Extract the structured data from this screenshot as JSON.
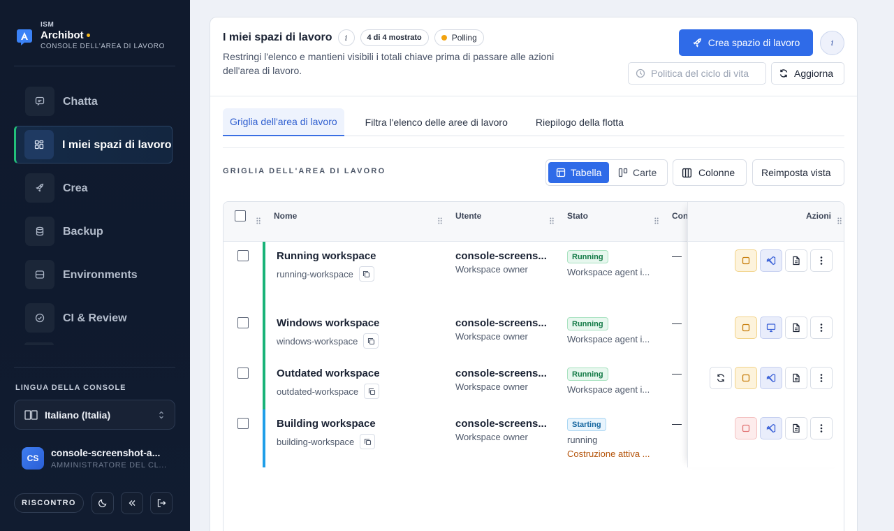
{
  "sidebar": {
    "brand": {
      "kicker": "ISM",
      "name": "Archibot",
      "subtitle": "CONSOLE DELL'AREA DI LAVORO"
    },
    "nav": [
      {
        "label": "Chatta",
        "icon": "chat-icon",
        "active": false
      },
      {
        "label": "I miei spazi di lavoro",
        "icon": "grid-icon",
        "active": true
      },
      {
        "label": "Crea",
        "icon": "rocket-icon",
        "active": false
      },
      {
        "label": "Backup",
        "icon": "database-icon",
        "active": false
      },
      {
        "label": "Environments",
        "icon": "server-icon",
        "active": false
      },
      {
        "label": "CI & Review",
        "icon": "check-circle-icon",
        "active": false
      }
    ],
    "language_label": "LINGUA DELLA CONSOLE",
    "language_value": "Italiano (Italia)",
    "user": {
      "initials": "CS",
      "name": "console-screenshot-a...",
      "role": "AMMINISTRATORE DEL CL..."
    },
    "feedback_label": "RISCONTRO"
  },
  "header": {
    "title": "I miei spazi di lavoro",
    "info": "i",
    "count_chip": "4 di 4 mostrato",
    "polling_chip": "Polling",
    "description": "Restringi l'elenco e mantieni visibili i totali chiave prima di passare alle azioni dell'area di lavoro.",
    "create_button": "Crea spazio di lavoro",
    "policy_button": "Politica del ciclo di vita",
    "refresh_button": "Aggiorna"
  },
  "tabs": [
    {
      "label": "Griglia dell'area di lavoro",
      "active": true
    },
    {
      "label": "Filtra l'elenco delle aree di lavoro",
      "active": false
    },
    {
      "label": "Riepilogo della flotta",
      "active": false
    }
  ],
  "toolbar": {
    "section_label": "GRIGLIA DELL'AREA DI LAVORO",
    "view_table": "Tabella",
    "view_cards": "Carte",
    "columns": "Colonne",
    "reset": "Reimposta vista"
  },
  "table": {
    "columns": {
      "name": "Nome",
      "user": "Utente",
      "status": "Stato",
      "truncated": "Con",
      "actions": "Azioni"
    },
    "rows": [
      {
        "name": "Running workspace",
        "slug": "running-workspace",
        "user": "console-screens...",
        "user_role": "Workspace owner",
        "status": "Running",
        "status_detail": "Workspace agent i...",
        "status_warning": "",
        "extra": "—",
        "accent": "#19b378",
        "actions": [
          "stop",
          "vscode",
          "logs",
          "more"
        ]
      },
      {
        "name": "Windows workspace",
        "slug": "windows-workspace",
        "user": "console-screens...",
        "user_role": "Workspace owner",
        "status": "Running",
        "status_detail": "Workspace agent i...",
        "status_warning": "",
        "extra": "—",
        "accent": "#19b378",
        "actions": [
          "stop",
          "remote-desktop",
          "logs",
          "more"
        ]
      },
      {
        "name": "Outdated workspace",
        "slug": "outdated-workspace",
        "user": "console-screens...",
        "user_role": "Workspace owner",
        "status": "Running",
        "status_detail": "Workspace agent i...",
        "status_warning": "",
        "extra": "—",
        "accent": "#19b378",
        "actions": [
          "update",
          "stop",
          "vscode",
          "logs",
          "more"
        ]
      },
      {
        "name": "Building workspace",
        "slug": "building-workspace",
        "user": "console-screens...",
        "user_role": "Workspace owner",
        "status": "Starting",
        "status_detail": "running",
        "status_warning": "Costruzione attiva ...",
        "extra": "—",
        "accent": "#1f9ee8",
        "actions": [
          "stop",
          "vscode",
          "logs",
          "more"
        ]
      }
    ]
  },
  "colors": {
    "primary": "#2f6be8",
    "running": "#19b378",
    "starting": "#1f9ee8",
    "polling": "#f2a30f",
    "brand_dot": "#f5b820"
  }
}
